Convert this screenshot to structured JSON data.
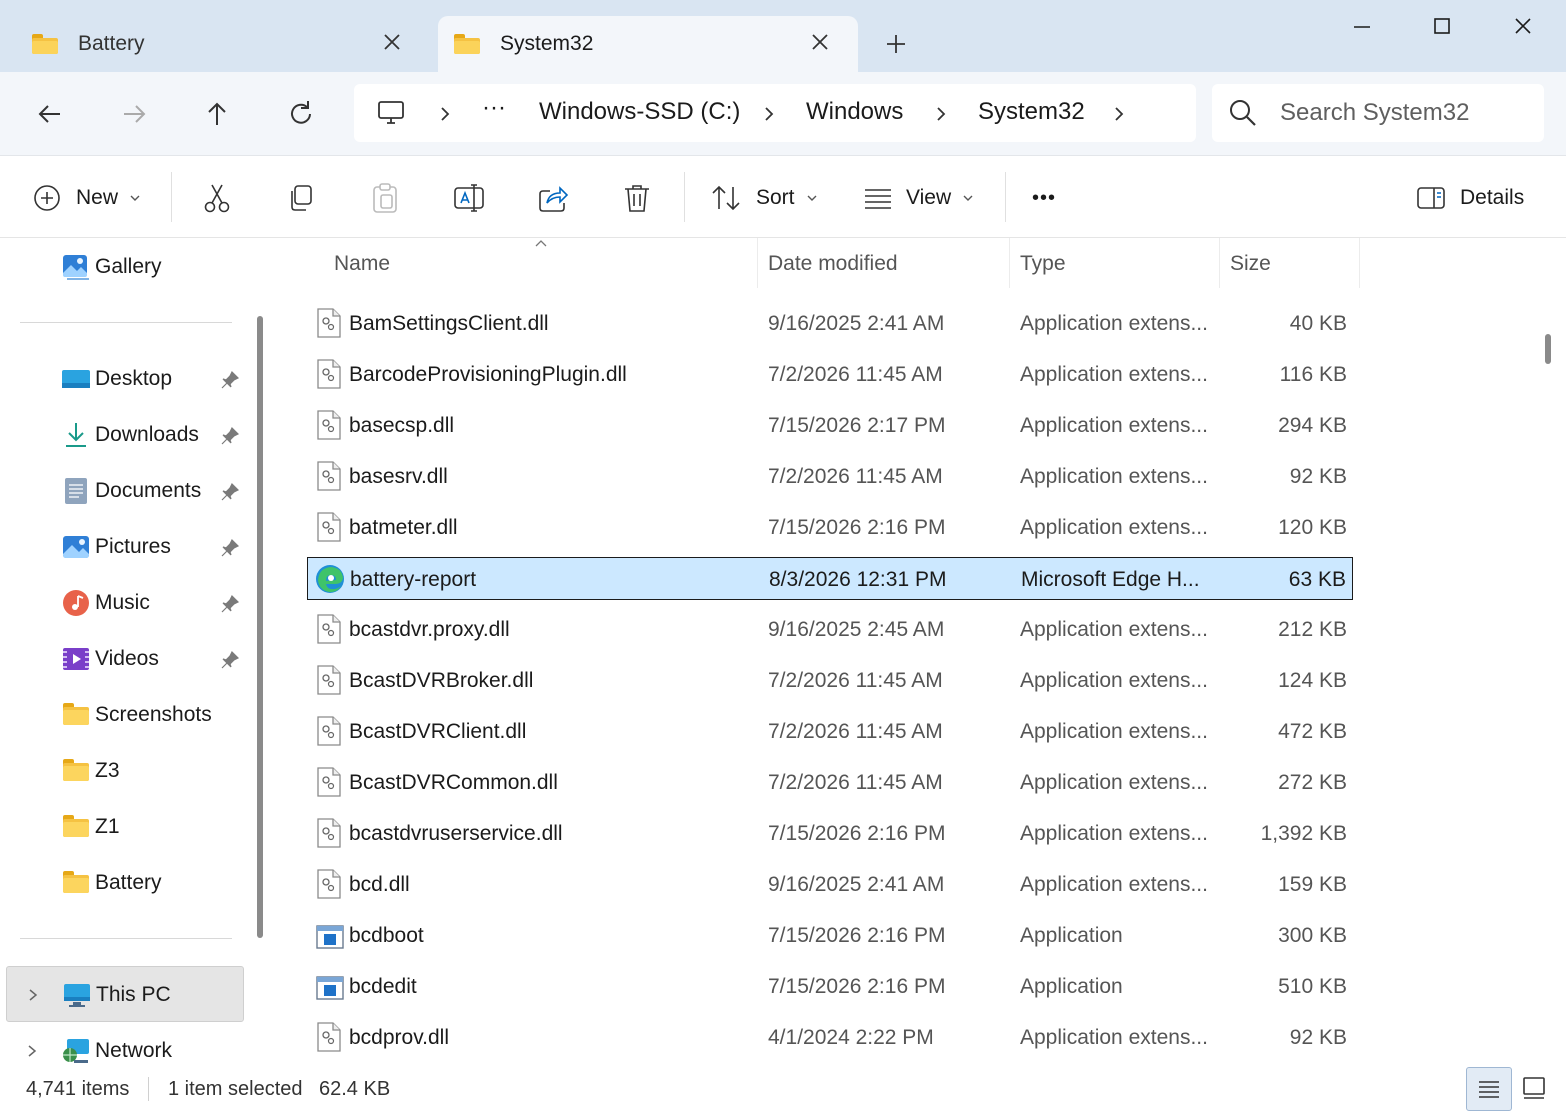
{
  "tabs": [
    {
      "label": "Battery",
      "active": false
    },
    {
      "label": "System32",
      "active": true
    }
  ],
  "breadcrumb": {
    "overflow": "···",
    "items": [
      "Windows-SSD (C:)",
      "Windows",
      "System32"
    ]
  },
  "search": {
    "placeholder": "Search System32"
  },
  "toolbar": {
    "new_label": "New",
    "sort_label": "Sort",
    "view_label": "View",
    "more_label": "•••",
    "details_label": "Details"
  },
  "sidebar": {
    "gallery": "Gallery",
    "quick_access": [
      {
        "label": "Desktop",
        "icon": "desktop-icon",
        "pinned": true
      },
      {
        "label": "Downloads",
        "icon": "downloads-icon",
        "pinned": true
      },
      {
        "label": "Documents",
        "icon": "documents-icon",
        "pinned": true
      },
      {
        "label": "Pictures",
        "icon": "pictures-icon",
        "pinned": true
      },
      {
        "label": "Music",
        "icon": "music-icon",
        "pinned": true
      },
      {
        "label": "Videos",
        "icon": "videos-icon",
        "pinned": true
      },
      {
        "label": "Screenshots",
        "icon": "folder-icon",
        "pinned": false
      },
      {
        "label": "Z3",
        "icon": "folder-icon",
        "pinned": false
      },
      {
        "label": "Z1",
        "icon": "folder-icon",
        "pinned": false
      },
      {
        "label": "Battery",
        "icon": "folder-icon",
        "pinned": false
      }
    ],
    "this_pc": "This PC",
    "network": "Network"
  },
  "columns": {
    "name": "Name",
    "date": "Date modified",
    "type": "Type",
    "size": "Size"
  },
  "files": [
    {
      "name": "BamSettingsClient.dll",
      "date": "9/16/2025 2:41 AM",
      "type": "Application extens...",
      "size": "40 KB",
      "icon": "dll-icon"
    },
    {
      "name": "BarcodeProvisioningPlugin.dll",
      "date": "7/2/2026 11:45 AM",
      "type": "Application extens...",
      "size": "116 KB",
      "icon": "dll-icon"
    },
    {
      "name": "basecsp.dll",
      "date": "7/15/2026 2:17 PM",
      "type": "Application extens...",
      "size": "294 KB",
      "icon": "dll-icon"
    },
    {
      "name": "basesrv.dll",
      "date": "7/2/2026 11:45 AM",
      "type": "Application extens...",
      "size": "92 KB",
      "icon": "dll-icon"
    },
    {
      "name": "batmeter.dll",
      "date": "7/15/2026 2:16 PM",
      "type": "Application extens...",
      "size": "120 KB",
      "icon": "dll-icon"
    },
    {
      "name": "battery-report",
      "date": "8/3/2026 12:31 PM",
      "type": "Microsoft Edge H...",
      "size": "63 KB",
      "icon": "edge-icon",
      "selected": true
    },
    {
      "name": "bcastdvr.proxy.dll",
      "date": "9/16/2025 2:45 AM",
      "type": "Application extens...",
      "size": "212 KB",
      "icon": "dll-icon"
    },
    {
      "name": "BcastDVRBroker.dll",
      "date": "7/2/2026 11:45 AM",
      "type": "Application extens...",
      "size": "124 KB",
      "icon": "dll-icon"
    },
    {
      "name": "BcastDVRClient.dll",
      "date": "7/2/2026 11:45 AM",
      "type": "Application extens...",
      "size": "472 KB",
      "icon": "dll-icon"
    },
    {
      "name": "BcastDVRCommon.dll",
      "date": "7/2/2026 11:45 AM",
      "type": "Application extens...",
      "size": "272 KB",
      "icon": "dll-icon"
    },
    {
      "name": "bcastdvruserservice.dll",
      "date": "7/15/2026 2:16 PM",
      "type": "Application extens...",
      "size": "1,392 KB",
      "icon": "dll-icon"
    },
    {
      "name": "bcd.dll",
      "date": "9/16/2025 2:41 AM",
      "type": "Application extens...",
      "size": "159 KB",
      "icon": "dll-icon"
    },
    {
      "name": "bcdboot",
      "date": "7/15/2026 2:16 PM",
      "type": "Application",
      "size": "300 KB",
      "icon": "app-icon"
    },
    {
      "name": "bcdedit",
      "date": "7/15/2026 2:16 PM",
      "type": "Application",
      "size": "510 KB",
      "icon": "app-icon"
    },
    {
      "name": "bcdprov.dll",
      "date": "4/1/2024 2:22 PM",
      "type": "Application extens...",
      "size": "92 KB",
      "icon": "dll-icon"
    }
  ],
  "status": {
    "item_count": "4,741 items",
    "selected": "1 item selected",
    "selected_size": "62.4 KB"
  },
  "colors": {
    "accent": "#0067c0",
    "selection": "#cce8ff",
    "titlebar": "#d9e5f2"
  }
}
